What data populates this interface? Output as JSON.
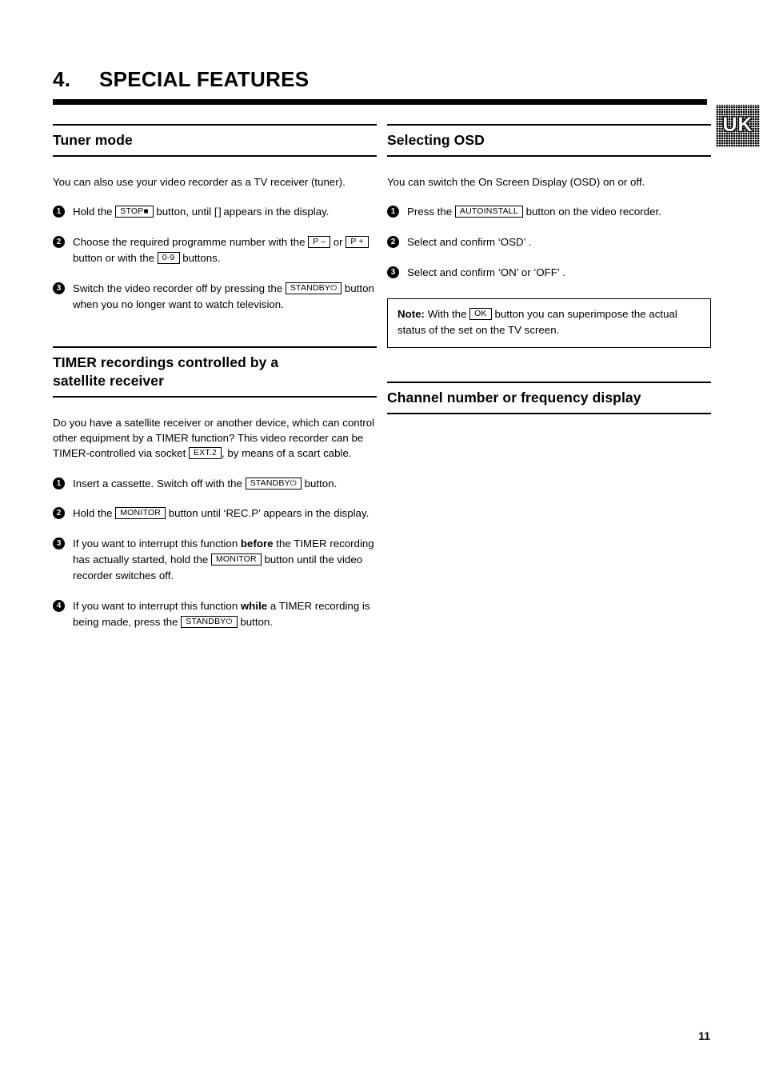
{
  "header": {
    "number": "4.",
    "title": "SPECIAL FEATURES",
    "locale_badge": "UK"
  },
  "left_column": {
    "section1": {
      "title": "Tuner mode",
      "intro": "You can also use your video recorder as a TV receiver (tuner).",
      "steps": [
        {
          "num": "1",
          "part1": "Hold the",
          "key1": "STOP",
          "key1_sym": "■",
          "part2": "button, until",
          "display": "[ ]",
          "part3": "appears in the display."
        },
        {
          "num": "2",
          "part1": "Choose the required programme number with the",
          "key1": "P",
          "key1_sym": "–",
          "part2": "or",
          "key2": "P",
          "key2_sym": "+",
          "part3": "button or with the",
          "key3": "0-9",
          "part4": "buttons."
        },
        {
          "num": "3",
          "part1": "Switch the video recorder off by pressing the",
          "key1": "STANDBY",
          "key1_sym": "⏻",
          "part2": "button when you no longer want to watch television."
        }
      ]
    },
    "section2": {
      "title_line1": "TIMER recordings controlled by a",
      "title_line2": "satellite receiver",
      "intro_part1": "Do you have a satellite receiver or another device, which can control other equipment by a TIMER function? This video recorder can be TIMER-controlled via socket",
      "intro_key": "EXT.2",
      "intro_part2": ", by means of a scart cable.",
      "steps": [
        {
          "num": "1",
          "part1": "Insert a cassette. Switch off with the",
          "key1": "STANDBY",
          "key1_sym": "⏻",
          "part2": "button."
        },
        {
          "num": "2",
          "part1": "Hold the",
          "key1": "MONITOR",
          "part2": "button until ‘REC.P’ appears in the display."
        },
        {
          "num": "3",
          "part1": "If you want to interrupt this function",
          "bold1": "before",
          "part2": "the TIMER recording has actually started, hold the",
          "key1": "MONITOR",
          "part3": "button until the video recorder switches off."
        },
        {
          "num": "4",
          "part1": "If you want to interrupt this function",
          "bold1": "while",
          "part2": "a TIMER recording is being made, press the",
          "key1": "STANDBY",
          "key1_sym": "⏻",
          "part3": "button."
        }
      ]
    }
  },
  "right_column": {
    "section1": {
      "title": "Selecting OSD",
      "intro": "You can switch the On Screen Display (OSD) on or off.",
      "steps": [
        {
          "num": "1",
          "part1": "Press the",
          "key1": "AUTOINSTALL",
          "part2": "button on the video recorder."
        },
        {
          "num": "2",
          "part1": "Select and confirm ‘OSD’ ."
        },
        {
          "num": "3",
          "part1": "Select and confirm ‘ON’ or ‘OFF’ ."
        }
      ],
      "note": {
        "label": "Note:",
        "part1": "With the",
        "key1": "OK",
        "part2": "button you can superimpose the actual status of the set on the TV screen."
      }
    },
    "section2": {
      "title": "Channel number or frequency display"
    }
  },
  "footer": {
    "page_number": "11"
  }
}
